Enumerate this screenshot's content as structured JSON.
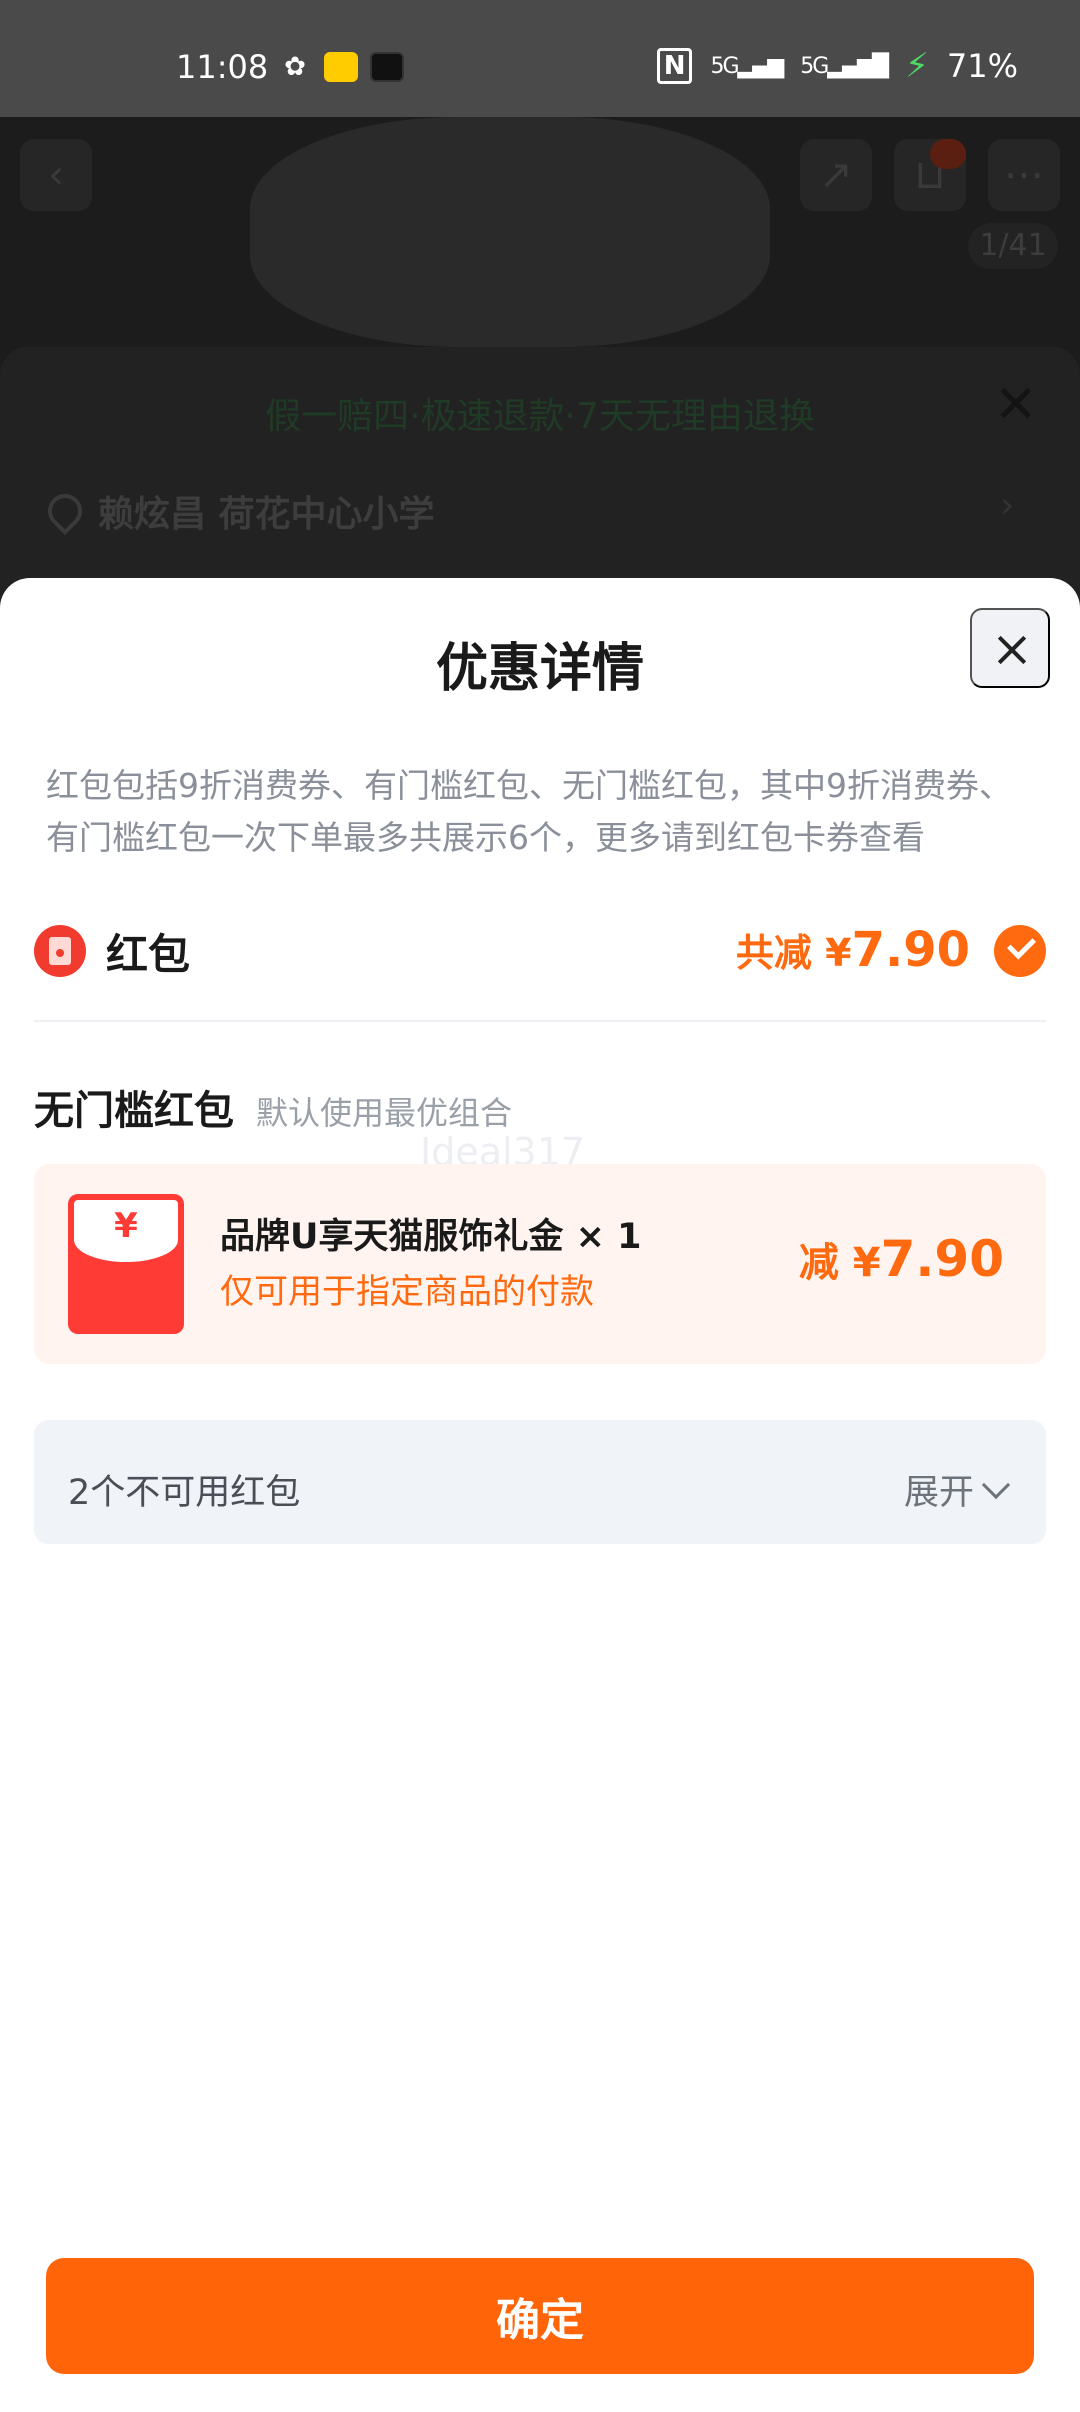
{
  "status_bar": {
    "time": "11:08",
    "battery": "71%",
    "signal_1": "5G",
    "signal_2": "5G",
    "nfc": "N"
  },
  "background_page": {
    "image_counter": "1/41",
    "guarantee_text": "假一赔四·极速退款·7天无理由退换",
    "address_text": "赖炫昌 荷花中心小学"
  },
  "sheet": {
    "title": "优惠详情",
    "description": "红包包括9折消费券、有门槛红包、无门槛红包，其中9折消费券、有门槛红包一次下单最多共展示6个，更多请到红包卡券查看",
    "red_packet": {
      "label": "红包",
      "total_prefix": "共减 ¥",
      "total_amount": "7.90",
      "selected": true
    },
    "section": {
      "title": "无门槛红包",
      "subtitle": "默认使用最优组合"
    },
    "watermark": "Ideal317",
    "coupon": {
      "yen_symbol": "¥",
      "name": "品牌U享天猫服饰礼金 × 1",
      "note": "仅可用于指定商品的付款",
      "amount_prefix": "减 ¥",
      "amount": "7.90"
    },
    "unavailable": {
      "text": "2个不可用红包",
      "expand_label": "展开"
    },
    "confirm_label": "确定"
  },
  "colors": {
    "accent": "#ff6408",
    "coupon_bg": "#fff4f0",
    "red_packet": "#ff3b35"
  }
}
